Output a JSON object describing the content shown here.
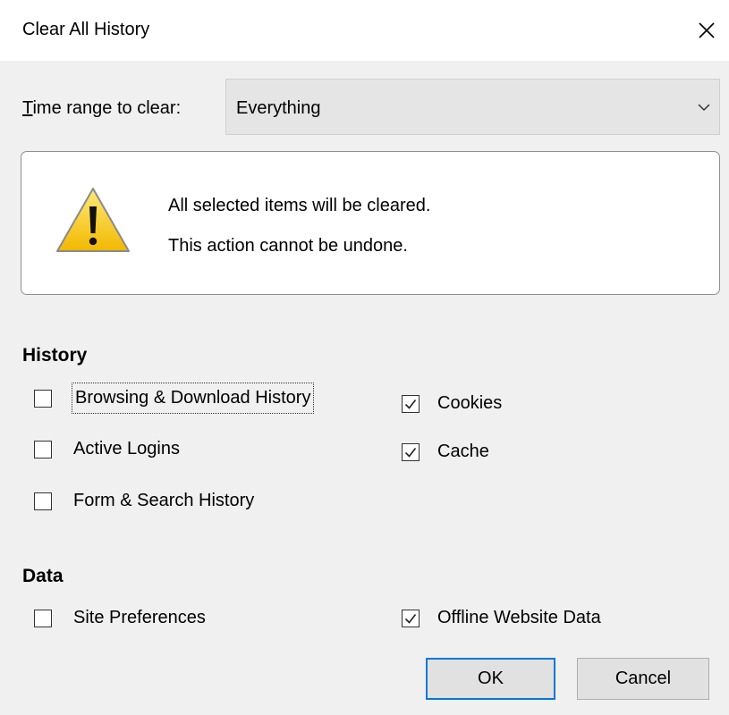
{
  "dialog": {
    "title": "Clear All History"
  },
  "time_range": {
    "label": "Time range to clear:",
    "selected": "Everything"
  },
  "warning": {
    "line1": "All selected items will be cleared.",
    "line2": "This action cannot be undone."
  },
  "history": {
    "heading": "History",
    "items": [
      {
        "label": "Browsing & Download History",
        "checked": false
      },
      {
        "label": "Active Logins",
        "checked": false
      },
      {
        "label": "Form & Search History",
        "checked": false
      },
      {
        "label": "Cookies",
        "checked": true
      },
      {
        "label": "Cache",
        "checked": true
      }
    ]
  },
  "data_section": {
    "heading": "Data",
    "items": [
      {
        "label": "Site Preferences",
        "checked": false
      },
      {
        "label": "Offline Website Data",
        "checked": true
      }
    ]
  },
  "buttons": {
    "ok": "OK",
    "cancel": "Cancel"
  },
  "colors": {
    "accent": "#0078d7",
    "dialog_bg": "#f0f0f0",
    "warning_yellow": "#f5c400"
  },
  "icons": {
    "close": "close-icon",
    "dropdown": "chevron-down-icon",
    "warning": "warning-icon",
    "check": "checkmark-icon"
  }
}
